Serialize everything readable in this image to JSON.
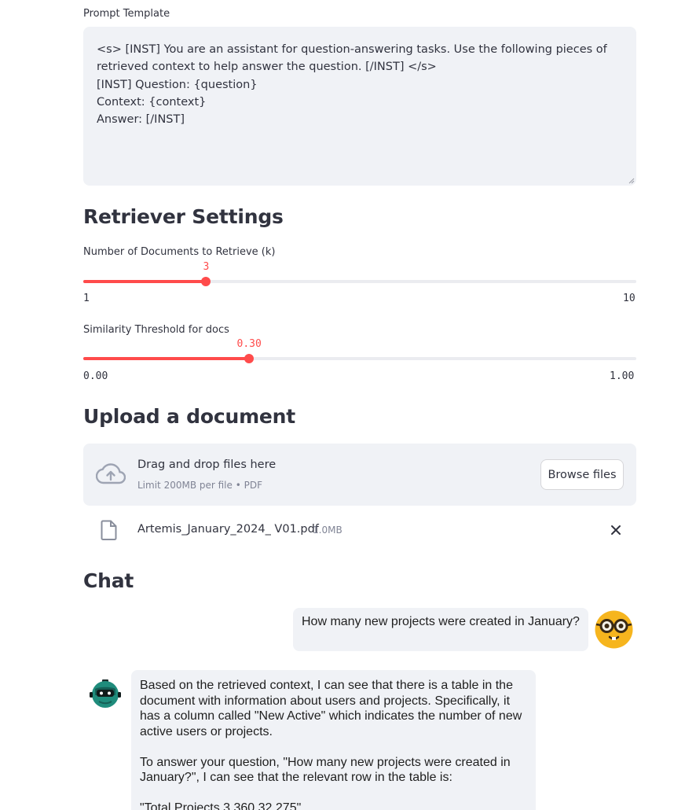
{
  "prompt_template": {
    "label": "Prompt Template",
    "value": "<s> [INST] You are an assistant for question-answering tasks. Use the following pieces of retrieved context to help answer the question. [/INST] </s>\n[INST] Question: {question}\nContext: {context}\nAnswer: [/INST]"
  },
  "retriever": {
    "heading": "Retriever Settings",
    "k_slider": {
      "label": "Number of Documents to Retrieve (k)",
      "value_text": "3",
      "min_text": "1",
      "max_text": "10",
      "value": 3,
      "min": 1,
      "max": 10
    },
    "threshold_slider": {
      "label": "Similarity Threshold for docs",
      "value_text": "0.30",
      "min_text": "0.00",
      "max_text": "1.00",
      "value": 0.3,
      "min": 0,
      "max": 1
    }
  },
  "upload": {
    "heading": "Upload a document",
    "dropzone_title": "Drag and drop files here",
    "dropzone_subtitle": "Limit 200MB per file • PDF",
    "browse_label": "Browse files",
    "file": {
      "name": "Artemis_January_2024_ V01.pdf",
      "size": "1.0MB"
    }
  },
  "chat": {
    "heading": "Chat",
    "user_message": "How many new projects were created in January?",
    "assistant_paragraphs": [
      "Based on the retrieved context, I can see that there is a table in the document with information about users and projects. Specifically, it has a column called \"New Active\" which indicates the number of new active users or projects.",
      "To answer your question, \"How many new projects were created in January?\", I can see that the relevant row in the table is:",
      "\"Total Projects 3,360 32 275\""
    ]
  },
  "colors": {
    "accent": "#ff4b4b",
    "input_background": "#f0f2f6",
    "text": "#31333f",
    "muted": "#808495"
  },
  "icons": {
    "upload": "cloud-upload-icon",
    "file": "file-icon",
    "remove": "close-icon",
    "user_avatar": "nerd-face-icon",
    "assistant_avatar": "robot-icon"
  }
}
